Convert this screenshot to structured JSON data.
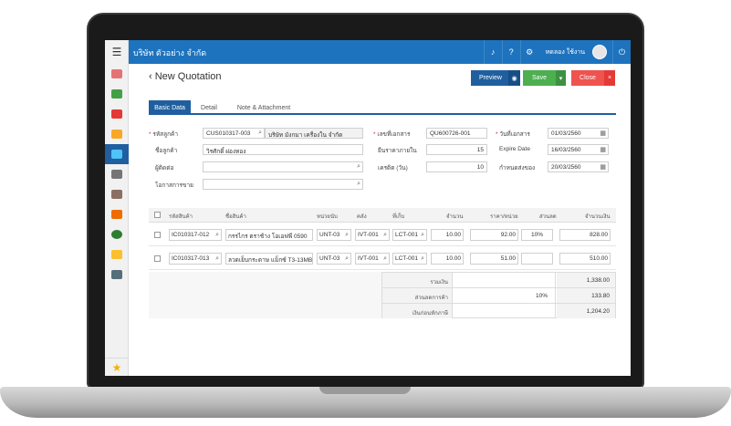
{
  "header": {
    "company": "บริษัท ตัวอย่าง จำกัด",
    "username": "ทดลอง ใช้งาน",
    "bell_icon": "bell-icon",
    "help_icon": "help-icon",
    "gear_icon": "gear-icon",
    "power_icon": "power-icon"
  },
  "page": {
    "back_icon": "‹",
    "title": "New Quotation"
  },
  "actions": {
    "preview": "Preview",
    "save": "Save",
    "close": "Close",
    "close_x": "×",
    "eye": "◉",
    "caret": "▾"
  },
  "tabs": [
    {
      "label": "Basic Data"
    },
    {
      "label": "Detail"
    },
    {
      "label": "Note & Attachment"
    }
  ],
  "form": {
    "customer_code_label": "รหัสลูกค้า",
    "customer_code_value": "CUS010317-003",
    "customer_company_value": "บริษัท มังกมา เครื่องใน จำกัด",
    "customer_name_label": "ชื่อลูกค้า",
    "customer_name_value": "วิรศักดิ์ ผ่องทอง",
    "contact_label": "ผู้ติดต่อ",
    "contact_value": "",
    "opportunity_label": "โอกาสการขาย",
    "opportunity_value": "",
    "doc_no_label": "เลขที่เอกสาร",
    "doc_no_value": "QU600726-001",
    "price_validity_label": "ยืนราคาภายใน",
    "price_validity_value": "15",
    "credit_label": "เครดิต (วัน)",
    "credit_value": "10",
    "doc_date_label": "วันที่เอกสาร",
    "doc_date_value": "01/03/2560",
    "expire_label": "Expire Date",
    "expire_value": "16/03/2560",
    "delivery_label": "กำหนดส่งของ",
    "delivery_value": "20/03/2560"
  },
  "table": {
    "columns": [
      "รหัสสินค้า",
      "ชื่อสินค้า",
      "หน่วยนับ",
      "คลัง",
      "ที่เก็บ",
      "จำนวน",
      "ราคา/หน่วย",
      "ส่วนลด",
      "จำนวนเงิน"
    ],
    "rows": [
      {
        "code": "IC010317-012",
        "name": "กรรไกร ตราช้าง โอเอฟพี 0590",
        "unit": "UNT-03",
        "wh": "IVT-001",
        "loc": "LCT-001",
        "qty": "10.00",
        "price": "92.00",
        "disc": "10%",
        "amount": "828.00"
      },
      {
        "code": "IC010317-013",
        "name": "ลวดเย็บกระดาษ แม็กซ์ T3-13MB",
        "unit": "UNT-03",
        "wh": "IVT-001",
        "loc": "LCT-001",
        "qty": "10.00",
        "price": "51.00",
        "disc": "",
        "amount": "510.00"
      }
    ]
  },
  "summary": {
    "total_label": "รวมเงิน",
    "total_value": "1,338.00",
    "discount_label": "ส่วนลดการค้า",
    "discount_pct": "10%",
    "discount_value": "133.80",
    "pretax_label": "เงินก่อนหักภาษี",
    "pretax_value": "1,204.20"
  },
  "colors": {
    "primary": "#1e73be",
    "save": "#4caf50",
    "close": "#ef5350"
  }
}
